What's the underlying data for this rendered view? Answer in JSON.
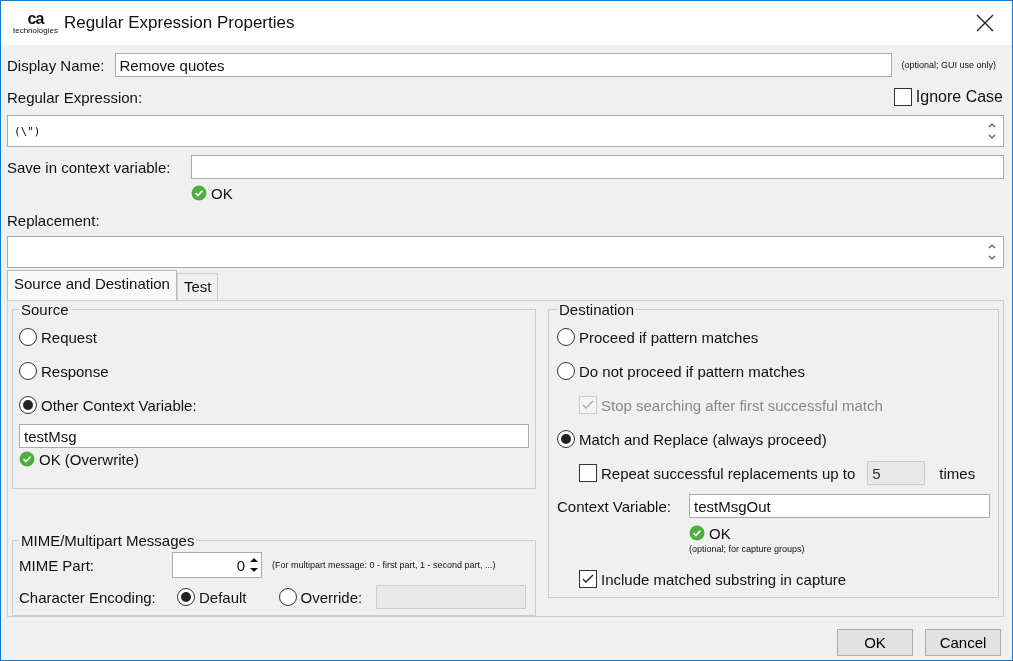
{
  "window": {
    "title": "Regular Expression Properties",
    "logo": {
      "mark": "ca",
      "tagline": "technologies"
    }
  },
  "display_name": {
    "label": "Display Name:",
    "value": "Remove quotes",
    "hint": "(optional; GUI use only)"
  },
  "regular_expression": {
    "label": "Regular Expression:",
    "value": "(\\\")",
    "ignore_case": {
      "label": "Ignore Case",
      "checked": false
    }
  },
  "save_variable": {
    "label": "Save in context variable:",
    "status": "OK"
  },
  "replacement": {
    "label": "Replacement:"
  },
  "tabs": [
    {
      "label": "Source and Destination",
      "selected": true
    },
    {
      "label": "Test",
      "selected": false
    }
  ],
  "source": {
    "title": "Source",
    "options": [
      {
        "label": "Request",
        "selected": false
      },
      {
        "label": "Response",
        "selected": false
      },
      {
        "label": "Other Context Variable:",
        "selected": true
      }
    ],
    "variable": "testMsg",
    "status": "OK (Overwrite)"
  },
  "mime": {
    "title": "MIME/Multipart Messages",
    "part_label": "MIME Part:",
    "part_value": "0",
    "part_hint": "(For multipart message: 0 - first part, 1 - second part, ...)",
    "encoding_label": "Character Encoding:",
    "encoding_options": [
      {
        "label": "Default",
        "selected": true
      },
      {
        "label": "Override:",
        "selected": false
      }
    ]
  },
  "destination": {
    "title": "Destination",
    "options": [
      {
        "kind": "radio",
        "label": "Proceed if pattern matches",
        "selected": false
      },
      {
        "kind": "radio",
        "label": "Do not proceed if pattern matches",
        "selected": false
      },
      {
        "kind": "checkbox",
        "label": "Stop searching after first successful match",
        "checked": true,
        "disabled": true
      },
      {
        "kind": "radio",
        "label": "Match and Replace (always proceed)",
        "selected": true
      }
    ],
    "repeat": {
      "label": "Repeat successful replacements up to",
      "checked": false,
      "value": "5",
      "suffix": "times"
    },
    "context_variable": {
      "label": "Context Variable:",
      "value": "testMsgOut",
      "status": "OK",
      "hint": "(optional; for capture groups)"
    },
    "include": {
      "label": "Include matched substring in capture",
      "checked": true
    }
  },
  "buttons": [
    {
      "label": "OK"
    },
    {
      "label": "Cancel"
    }
  ]
}
